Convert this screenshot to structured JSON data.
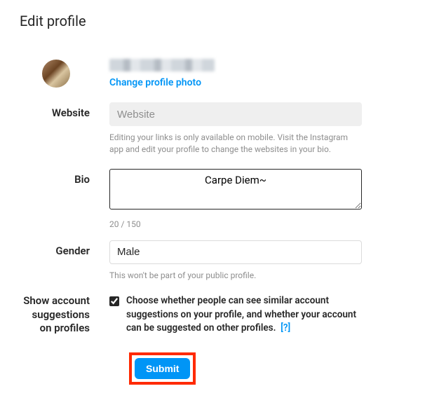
{
  "page": {
    "title": "Edit profile"
  },
  "profile": {
    "change_photo_label": "Change profile photo"
  },
  "website": {
    "label": "Website",
    "placeholder": "Website",
    "value": "",
    "helper": "Editing your links is only available on mobile. Visit the Instagram app and edit your profile to change the websites in your bio."
  },
  "bio": {
    "label": "Bio",
    "value": "Carpe Diem~",
    "counter": "20 / 150"
  },
  "gender": {
    "label": "Gender",
    "value": "Male",
    "helper": "This won't be part of your public profile."
  },
  "suggestions": {
    "label": "Show account suggestions on profiles",
    "checked": true,
    "text": "Choose whether people can see similar account suggestions on your profile, and whether your account can be suggested on other profiles.",
    "help_link": "[?]"
  },
  "submit": {
    "label": "Submit"
  }
}
